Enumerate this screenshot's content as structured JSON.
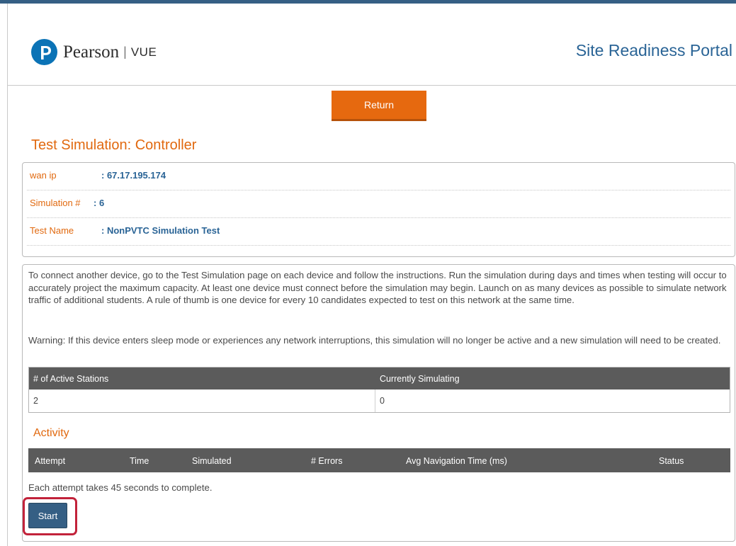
{
  "header": {
    "brand_name": "Pearson",
    "brand_separator": "|",
    "brand_product": "VUE",
    "portal_title": "Site Readiness Portal"
  },
  "actions": {
    "return_label": "Return",
    "start_label": "Start"
  },
  "page": {
    "title": "Test Simulation: Controller"
  },
  "info": [
    {
      "label": "wan ip",
      "value": ": 67.17.195.174"
    },
    {
      "label": "Simulation #",
      "value": ": 6"
    },
    {
      "label": "Test Name",
      "value": ": NonPVTC Simulation Test"
    }
  ],
  "instructions": {
    "paragraph": "To connect another device, go to the Test Simulation page on each device and follow the instructions. Run the simulation during days and times when testing will occur to accurately project the maximum capacity. At least one device must connect before the simulation may begin. Launch on as many devices as possible to simulate network traffic of additional students. A rule of thumb is one device for every 10 candidates expected to test on this network at the same time.",
    "warning": "Warning: If this device enters sleep mode or experiences any network interruptions, this simulation will no longer be active and a new simulation will need to be created."
  },
  "stations_table": {
    "headers": [
      "# of Active Stations",
      "Currently Simulating"
    ],
    "row": [
      "2",
      "0"
    ]
  },
  "activity": {
    "title": "Activity",
    "headers": [
      "Attempt",
      "Time",
      "Simulated",
      "# Errors",
      "Avg Navigation Time (ms)",
      "Status"
    ],
    "note": "Each attempt takes 45 seconds to complete."
  },
  "colors": {
    "accent_orange": "#e6690f",
    "brand_blue": "#0b73b6",
    "link_blue": "#2a6496",
    "header_bar": "#355f84",
    "table_header": "#5b5b5b",
    "highlight_red": "#c2223a"
  }
}
